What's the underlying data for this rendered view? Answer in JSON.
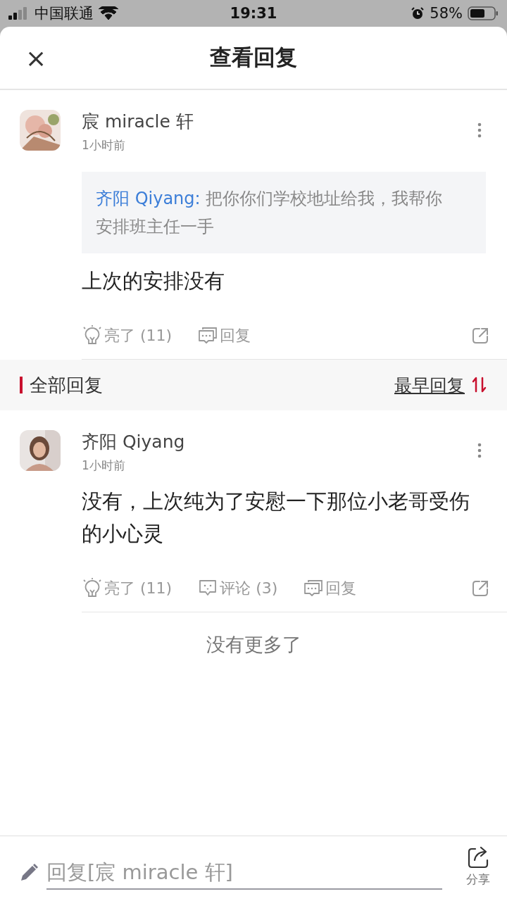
{
  "status_bar": {
    "carrier": "中国联通",
    "time": "19:31",
    "battery": "58%"
  },
  "header": {
    "close": "×",
    "title": "查看回复"
  },
  "main_post": {
    "author": "宸 miracle 轩",
    "time": "1小时前",
    "quote": {
      "author": "齐阳 Qiyang:",
      "text": "把你你们学校地址给我，我帮你安排班主任一手"
    },
    "text": "上次的安排没有",
    "actions": [
      {
        "kind": "like",
        "label": "亮了 (11)"
      },
      {
        "kind": "reply",
        "label": "回复"
      }
    ]
  },
  "section": {
    "title": "全部回复",
    "sort": "最早回复"
  },
  "replies": [
    {
      "author": "齐阳 Qiyang",
      "time": "1小时前",
      "text": "没有，上次纯为了安慰一下那位小老哥受伤的小心灵",
      "actions": [
        {
          "kind": "like",
          "label": "亮了 (11)"
        },
        {
          "kind": "comment",
          "label": "评论 (3)"
        },
        {
          "kind": "reply",
          "label": "回复"
        }
      ]
    }
  ],
  "end_note": "没有更多了",
  "bottom_bar": {
    "placeholder": "回复[宸 miracle 轩]",
    "share": "分享"
  }
}
